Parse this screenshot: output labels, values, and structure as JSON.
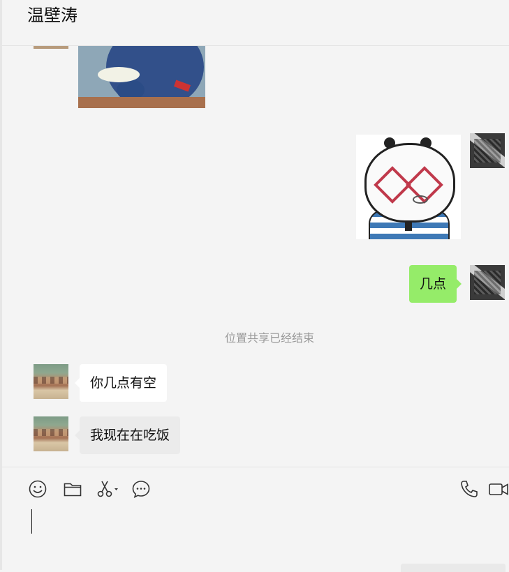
{
  "header": {
    "title": "温壁涛"
  },
  "messages": {
    "self_text": "几点",
    "system_note": "位置共享已经结束",
    "other_text_1": "你几点有空",
    "other_text_2": "我现在在吃饭"
  },
  "toolbar": {
    "icons": [
      "emoji-icon",
      "folder-icon",
      "scissors-icon",
      "chat-history-icon",
      "phone-icon",
      "video-icon"
    ]
  },
  "input": {
    "value": ""
  },
  "colors": {
    "background": "#f4f4f4",
    "self_bubble": "#95ec69",
    "other_bubble": "#ffffff",
    "system_text": "#9a9a9a"
  }
}
